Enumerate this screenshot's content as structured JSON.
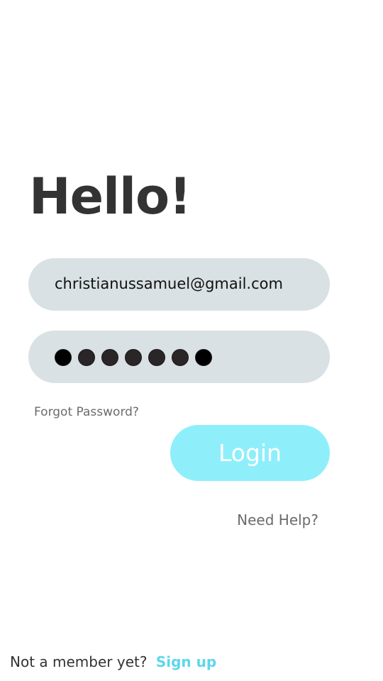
{
  "header": {
    "title": "Hello!"
  },
  "form": {
    "email_value": "christianussamuel@gmail.com",
    "password_mask_count": 7,
    "forgot_label": "Forgot Password?",
    "login_label": "Login",
    "help_label": "Need Help?"
  },
  "footer": {
    "prompt": "Not a member yet?",
    "signup_label": "Sign up"
  },
  "colors": {
    "title_text": "#333333",
    "field_background": "#d9e1e4",
    "login_button_background": "#8eeffb",
    "login_button_text": "#ffffff",
    "secondary_text": "#6b6b6b",
    "signup_link": "#5fd6ec"
  }
}
